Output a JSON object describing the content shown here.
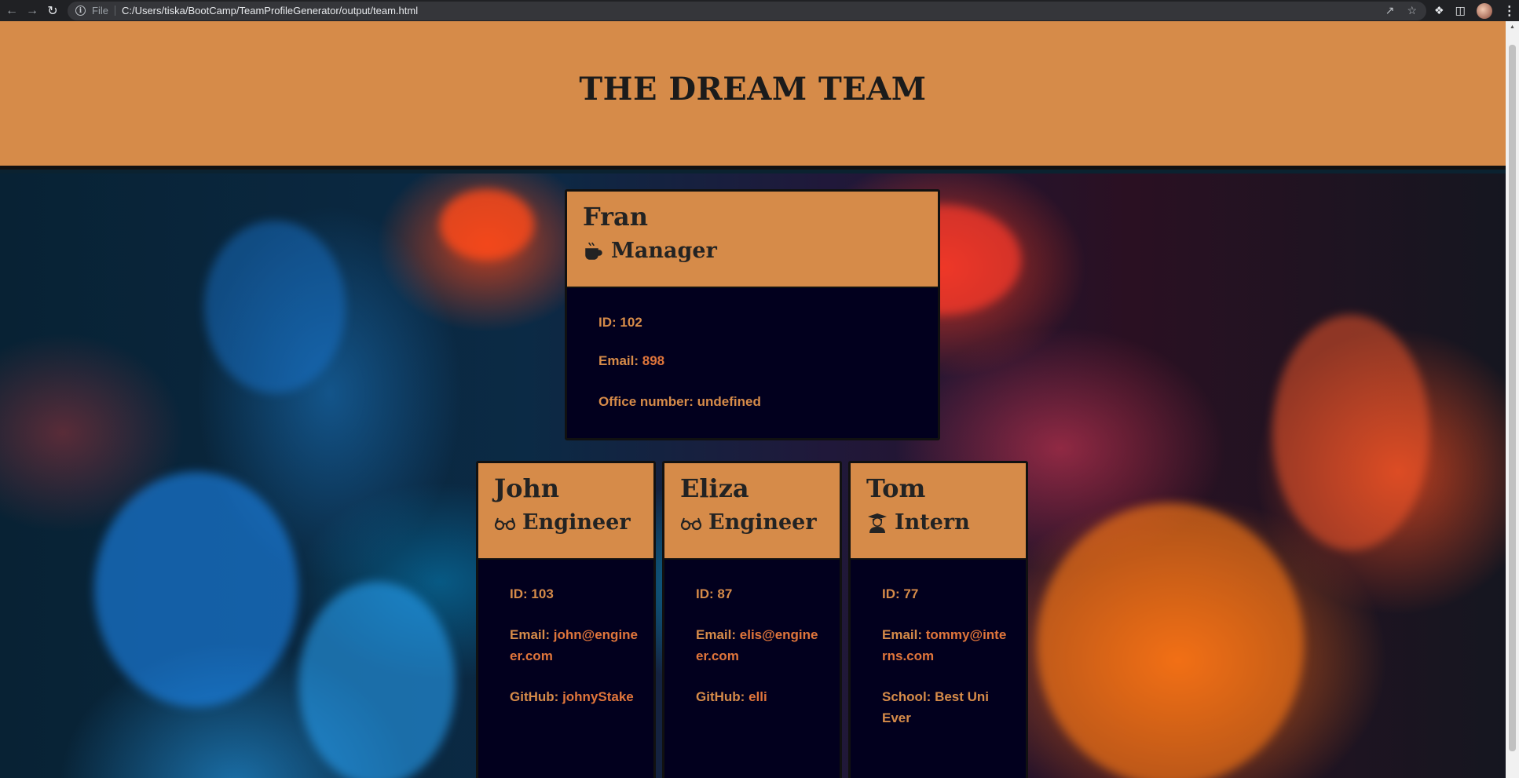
{
  "browser": {
    "file_label": "File",
    "url": "C:/Users/tiska/BootCamp/TeamProfileGenerator/output/team.html"
  },
  "page": {
    "title": "THE DREAM TEAM",
    "colors": {
      "header": "#d68b49",
      "card_body": "#02001e",
      "text": "#d68b49"
    }
  },
  "manager": {
    "name": "Fran",
    "role": "Manager",
    "icon": "mug-icon",
    "id_label": "ID:",
    "id": "102",
    "email_label": "Email:",
    "email": "898",
    "office_label": "Office number:",
    "office": "undefined"
  },
  "engineers": [
    {
      "name": "John",
      "role": "Engineer",
      "icon": "glasses-icon",
      "id_label": "ID:",
      "id": "103",
      "email_label": "Email:",
      "email": "john@engineer.com",
      "github_label": "GitHub:",
      "github": "johnyStake"
    },
    {
      "name": "Eliza",
      "role": "Engineer",
      "icon": "glasses-icon",
      "id_label": "ID:",
      "id": "87",
      "email_label": "Email:",
      "email": "elis@engineer.com",
      "github_label": "GitHub:",
      "github": "elli"
    }
  ],
  "intern": {
    "name": "Tom",
    "role": "Intern",
    "icon": "graduate-icon",
    "id_label": "ID:",
    "id": "77",
    "email_label": "Email:",
    "email": "tommy@interns.com",
    "school_label": "School:",
    "school": "Best Uni Ever"
  }
}
